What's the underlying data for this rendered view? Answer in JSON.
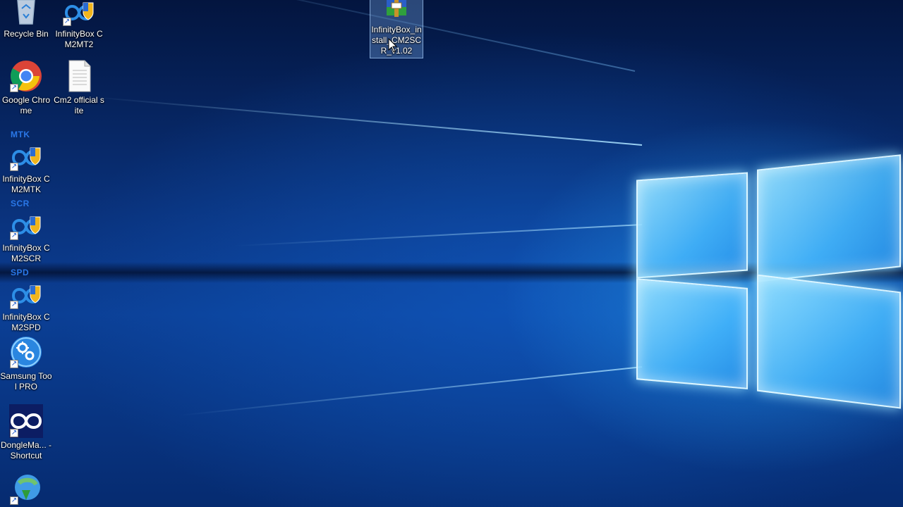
{
  "desktop": {
    "icons": [
      {
        "label": "Recycle Bin",
        "icon": "recycle-bin-icon"
      },
      {
        "label": "InfinityBox CM2MT2",
        "icon": "infinitybox-icon"
      },
      {
        "label": "InfinityBox_install_CM2SCR_v1.02",
        "icon": "winrar-archive-icon"
      },
      {
        "label": "Google Chrome",
        "icon": "chrome-icon"
      },
      {
        "label": "Cm2 official site",
        "icon": "document-icon"
      },
      {
        "label": "InfinityBox CM2MTK",
        "prefix": "MTK",
        "icon": "infinitybox-icon"
      },
      {
        "label": "InfinityBox CM2SCR",
        "prefix": "SCR",
        "icon": "infinitybox-icon"
      },
      {
        "label": "InfinityBox CM2SPD",
        "prefix": "SPD",
        "icon": "infinitybox-icon"
      },
      {
        "label": "Samsung Tool PRO",
        "icon": "samsung-tool-icon"
      },
      {
        "label": "DongleMa... - Shortcut",
        "icon": "dongle-manager-icon"
      },
      {
        "label": "",
        "icon": "internet-download-manager-icon"
      }
    ]
  },
  "wallpaper": {
    "name": "Windows 10 hero",
    "accent": "#2ea6ff"
  }
}
